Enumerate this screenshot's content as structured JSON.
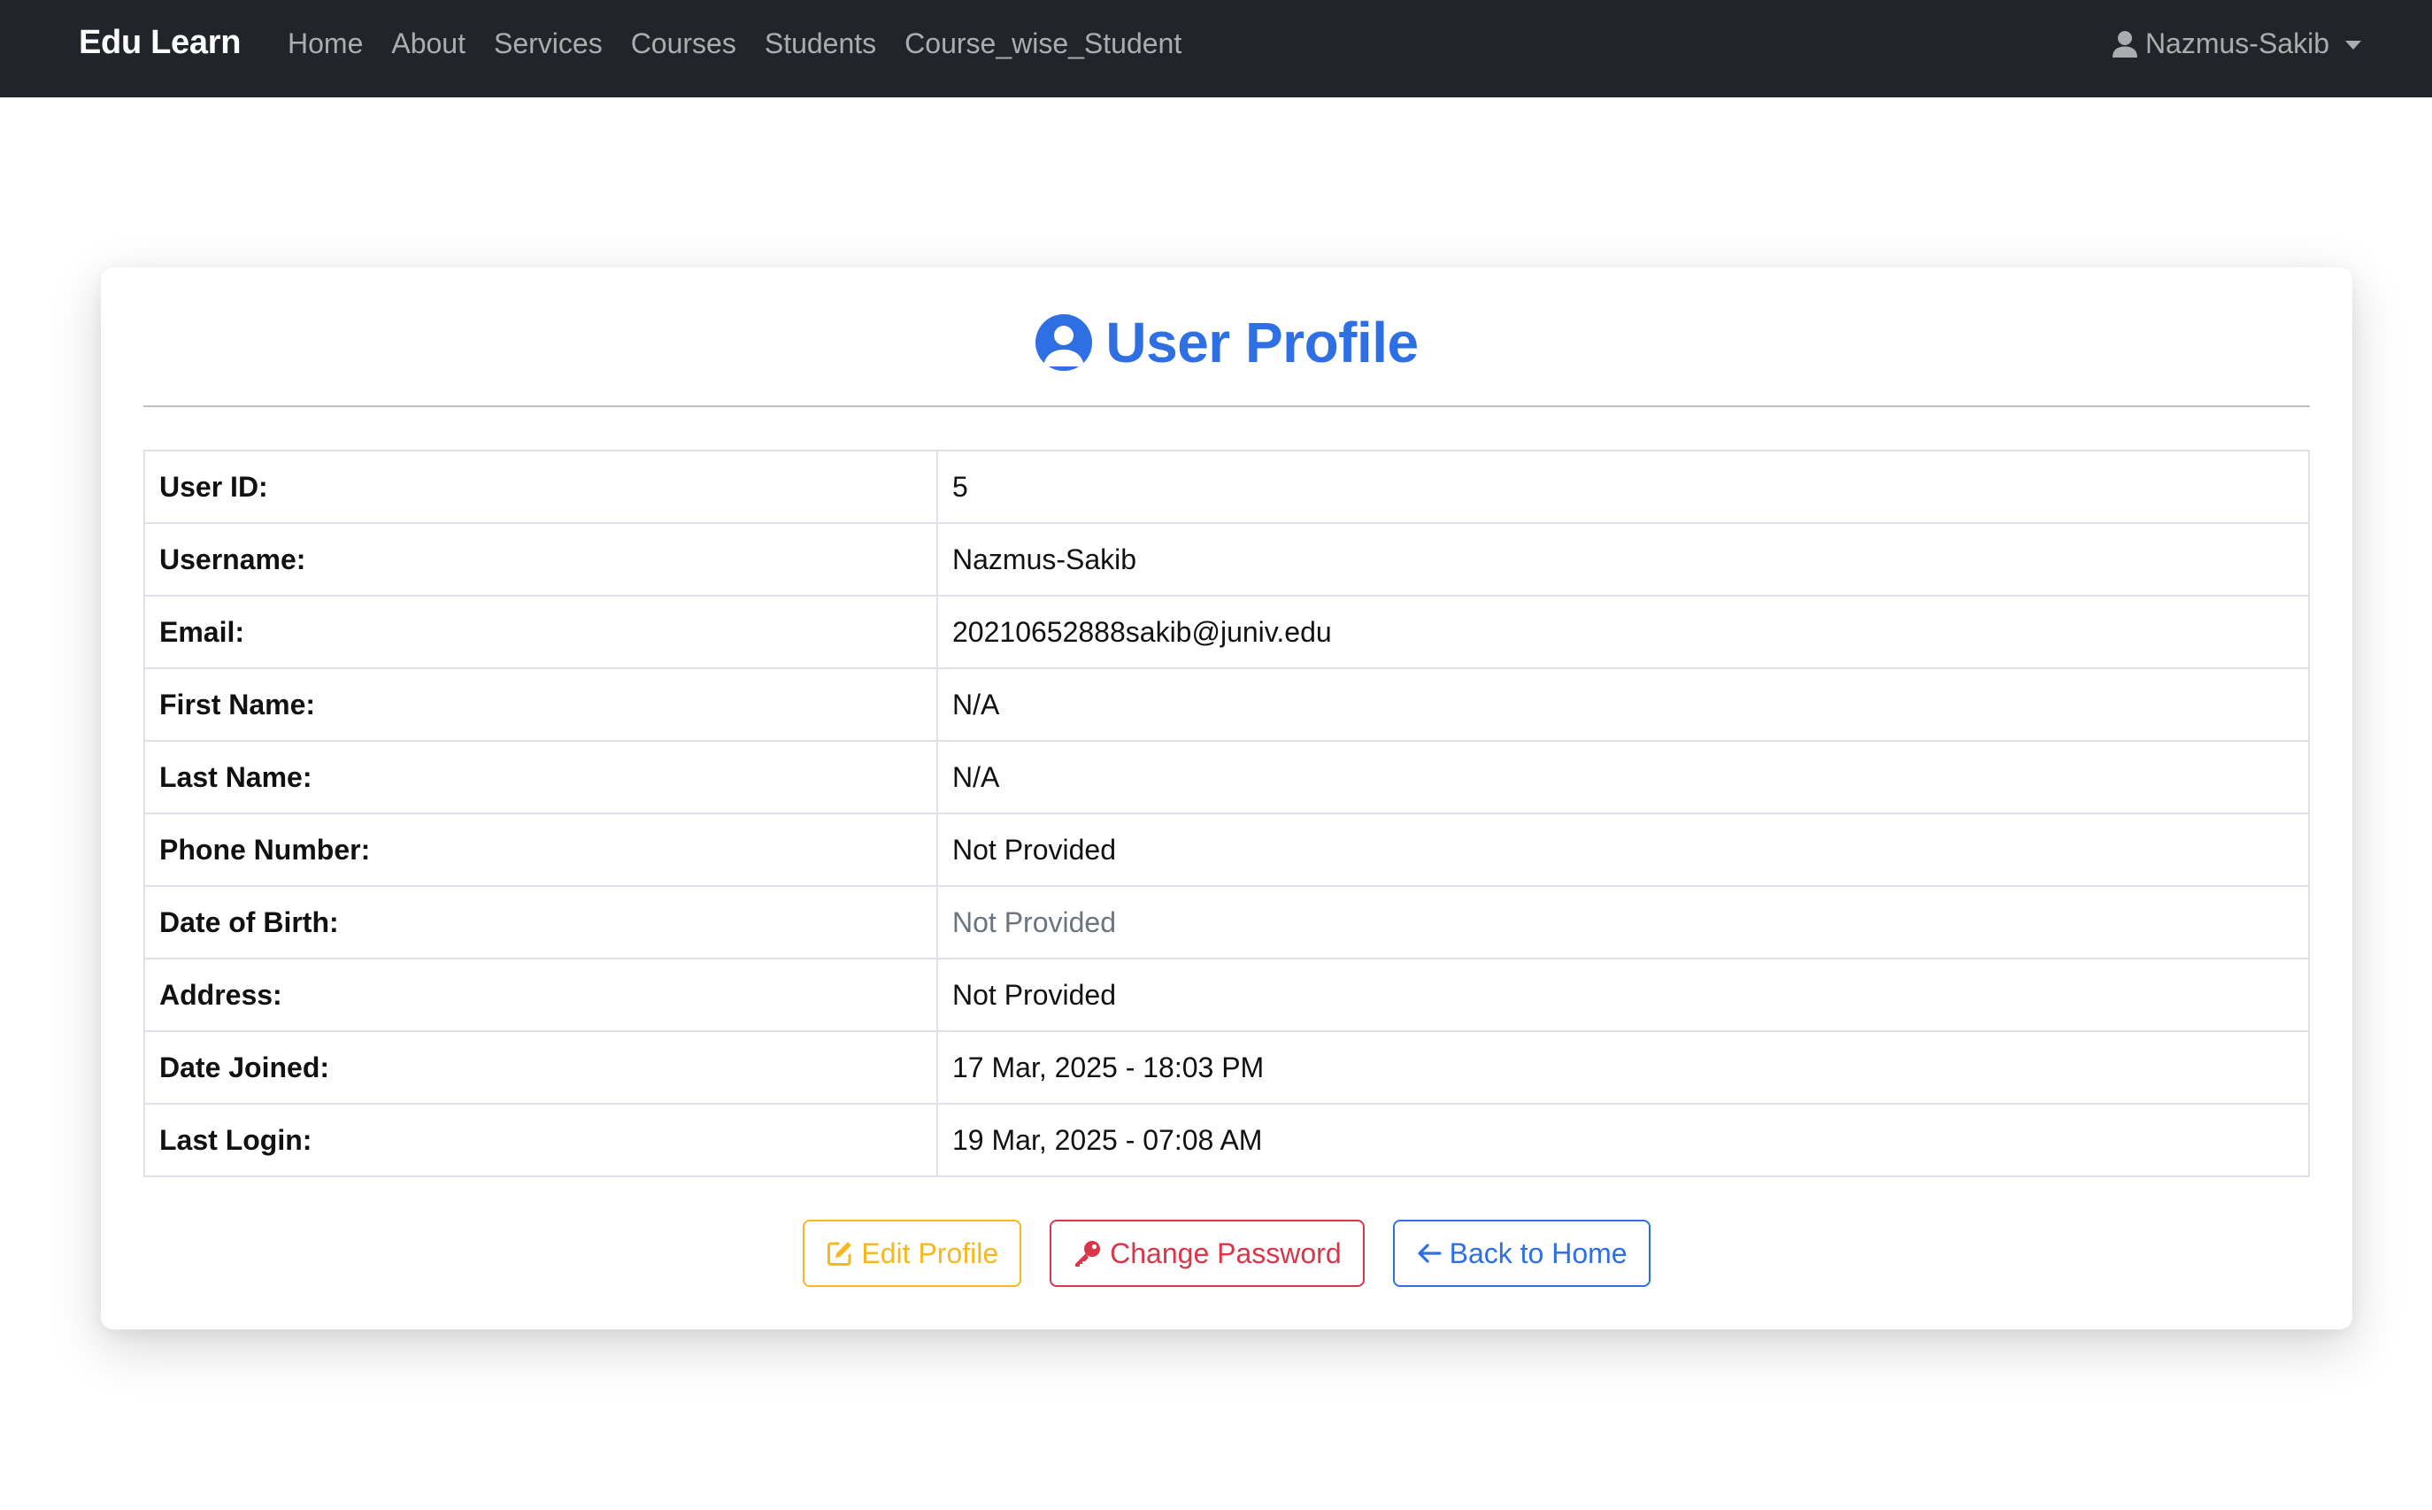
{
  "navbar": {
    "brand": "Edu Learn",
    "links": [
      "Home",
      "About",
      "Services",
      "Courses",
      "Students",
      "Course_wise_Student"
    ],
    "user": "Nazmus-Sakib"
  },
  "profile": {
    "title": "User Profile",
    "rows": [
      {
        "label": "User ID:",
        "value": "5"
      },
      {
        "label": "Username:",
        "value": "Nazmus-Sakib"
      },
      {
        "label": "Email:",
        "value": "20210652888sakib@juniv.edu"
      },
      {
        "label": "First Name:",
        "value": "N/A"
      },
      {
        "label": "Last Name:",
        "value": "N/A"
      },
      {
        "label": "Phone Number:",
        "value": "Not Provided"
      },
      {
        "label": "Date of Birth:",
        "value": "Not Provided"
      },
      {
        "label": "Address:",
        "value": "Not Provided"
      },
      {
        "label": "Date Joined:",
        "value": "17 Mar, 2025 - 18:03 PM"
      },
      {
        "label": "Last Login:",
        "value": "19 Mar, 2025 - 07:08 AM"
      }
    ]
  },
  "buttons": {
    "edit": "Edit Profile",
    "change_password": "Change Password",
    "back": "Back to Home"
  },
  "icons": {
    "user_menu": "user-icon",
    "title": "user-circle-icon",
    "edit": "edit-icon",
    "change_password": "key-icon",
    "back": "arrow-left-icon"
  },
  "colors": {
    "navbar": "#212529",
    "primary": "#2f6fe4",
    "warning": "#f5b821",
    "danger": "#d9364a"
  }
}
